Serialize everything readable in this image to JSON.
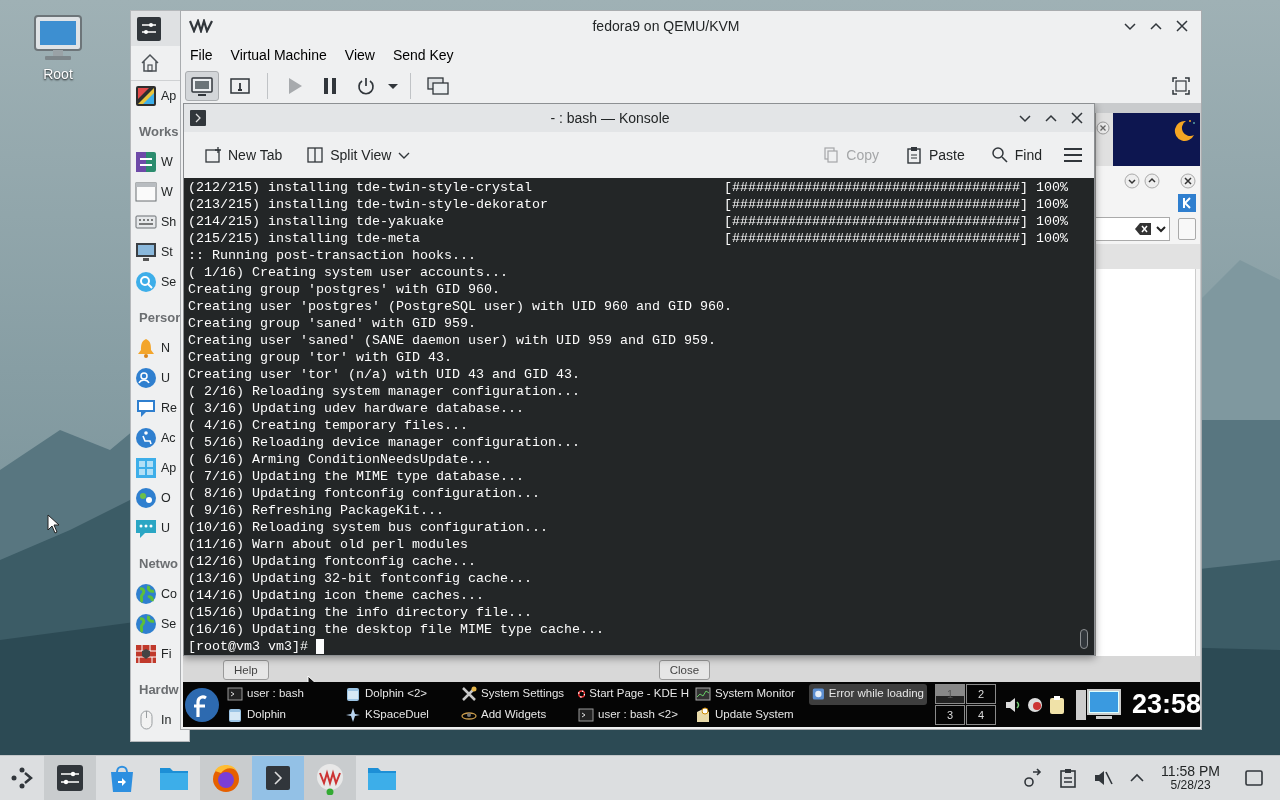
{
  "desktop": {
    "icons": [
      {
        "label": "Root"
      }
    ]
  },
  "settings_sidebar": [
    {
      "kind": "item",
      "label": "Ap"
    },
    {
      "kind": "header",
      "label": "Works"
    },
    {
      "kind": "item",
      "label": "W"
    },
    {
      "kind": "item",
      "label": "W"
    },
    {
      "kind": "item",
      "label": "Sh"
    },
    {
      "kind": "item",
      "label": "St"
    },
    {
      "kind": "item",
      "label": "Se"
    },
    {
      "kind": "header",
      "label": "Persor"
    },
    {
      "kind": "item",
      "label": "N"
    },
    {
      "kind": "item",
      "label": "U"
    },
    {
      "kind": "item",
      "label": "Re"
    },
    {
      "kind": "item",
      "label": "Ac"
    },
    {
      "kind": "item",
      "label": "Ap"
    },
    {
      "kind": "item",
      "label": "O"
    },
    {
      "kind": "item",
      "label": "U"
    },
    {
      "kind": "header",
      "label": "Netwo"
    },
    {
      "kind": "item",
      "label": "Co"
    },
    {
      "kind": "item",
      "label": "Se"
    },
    {
      "kind": "item",
      "label": "Fi"
    },
    {
      "kind": "header",
      "label": "Hardw"
    },
    {
      "kind": "item",
      "label": "In"
    }
  ],
  "vm_window": {
    "title": "fedora9 on QEMU/KVM",
    "menu": [
      "File",
      "Virtual Machine",
      "View",
      "Send Key"
    ],
    "view_buttons": [
      {
        "selected": true
      },
      {
        "selected": false
      }
    ],
    "run_buttons": [
      {
        "disabled": true
      },
      {
        "disabled": false
      },
      {
        "disabled": false
      }
    ]
  },
  "konsole": {
    "title": "- : bash — Konsole",
    "toolbar": [
      {
        "label": "New Tab",
        "disabled": false
      },
      {
        "label": "Split View",
        "disabled": false
      },
      {
        "label": "Copy",
        "disabled": true
      },
      {
        "label": "Paste",
        "disabled": false
      },
      {
        "label": "Find",
        "disabled": false
      }
    ],
    "lines": [
      {
        "kind": "progress",
        "text": "(212/215) installing tde-twin-style-crystal",
        "bar": "[####################################]",
        "percent": "100%"
      },
      {
        "kind": "progress",
        "text": "(213/215) installing tde-twin-style-dekorator",
        "bar": "[####################################]",
        "percent": "100%"
      },
      {
        "kind": "progress",
        "text": "(214/215) installing tde-yakuake",
        "bar": "[####################################]",
        "percent": "100%"
      },
      {
        "kind": "progress",
        "text": "(215/215) installing tde-meta",
        "bar": "[####################################]",
        "percent": "100%"
      },
      {
        "kind": "plain",
        "text": ":: Running post-transaction hooks..."
      },
      {
        "kind": "plain",
        "text": "( 1/16) Creating system user accounts..."
      },
      {
        "kind": "plain",
        "text": "Creating group 'postgres' with GID 960."
      },
      {
        "kind": "plain",
        "text": "Creating user 'postgres' (PostgreSQL user) with UID 960 and GID 960."
      },
      {
        "kind": "plain",
        "text": "Creating group 'saned' with GID 959."
      },
      {
        "kind": "plain",
        "text": "Creating user 'saned' (SANE daemon user) with UID 959 and GID 959."
      },
      {
        "kind": "plain",
        "text": "Creating group 'tor' with GID 43."
      },
      {
        "kind": "plain",
        "text": "Creating user 'tor' (n/a) with UID 43 and GID 43."
      },
      {
        "kind": "plain",
        "text": "( 2/16) Reloading system manager configuration..."
      },
      {
        "kind": "plain",
        "text": "( 3/16) Updating udev hardware database..."
      },
      {
        "kind": "plain",
        "text": "( 4/16) Creating temporary files..."
      },
      {
        "kind": "plain",
        "text": "( 5/16) Reloading device manager configuration..."
      },
      {
        "kind": "plain",
        "text": "( 6/16) Arming ConditionNeedsUpdate..."
      },
      {
        "kind": "plain",
        "text": "( 7/16) Updating the MIME type database..."
      },
      {
        "kind": "plain",
        "text": "( 8/16) Updating fontconfig configuration..."
      },
      {
        "kind": "plain",
        "text": "( 9/16) Refreshing PackageKit..."
      },
      {
        "kind": "plain",
        "text": "(10/16) Reloading system bus configuration..."
      },
      {
        "kind": "plain",
        "text": "(11/16) Warn about old perl modules"
      },
      {
        "kind": "plain",
        "text": "(12/16) Updating fontconfig cache..."
      },
      {
        "kind": "plain",
        "text": "(13/16) Updating 32-bit fontconfig cache..."
      },
      {
        "kind": "plain",
        "text": "(14/16) Updating icon theme caches..."
      },
      {
        "kind": "plain",
        "text": "(15/16) Updating the info directory file..."
      },
      {
        "kind": "plain",
        "text": "(16/16) Updating the desktop file MIME type cache..."
      }
    ],
    "prompt": "[root@vm3 vm3]#"
  },
  "guest_dialog": {
    "buttons": [
      "Help",
      "Close"
    ]
  },
  "guest_taskbar": {
    "tasks": [
      {
        "label": "user : bash",
        "selected": false
      },
      {
        "label": "Dolphin <2>",
        "selected": false
      },
      {
        "label": "System Settings",
        "selected": false
      },
      {
        "label": "Start Page - KDE H",
        "selected": false
      },
      {
        "label": "System Monitor",
        "selected": false
      },
      {
        "label": "Error while loading",
        "selected": true
      },
      {
        "label": "Dolphin",
        "selected": false
      },
      {
        "label": "KSpaceDuel",
        "selected": false
      },
      {
        "label": "Add Widgets",
        "selected": false
      },
      {
        "label": "user : bash <2>",
        "selected": false
      },
      {
        "label": "Update System",
        "selected": false
      }
    ],
    "desktops": [
      {
        "label": "1",
        "selected": true
      },
      {
        "label": "2",
        "selected": false
      },
      {
        "label": "3",
        "selected": false
      },
      {
        "label": "4",
        "selected": false
      }
    ],
    "clock": "23:58"
  },
  "host_taskbar": {
    "tasks": [
      {
        "open": true,
        "selected": false
      },
      {
        "open": false,
        "selected": false
      },
      {
        "open": false,
        "selected": false
      },
      {
        "open": true,
        "selected": false
      },
      {
        "open": true,
        "selected": true
      },
      {
        "open": true,
        "selected": false
      },
      {
        "open": false,
        "selected": false
      }
    ],
    "clock": "11:58 PM",
    "date": "5/28/23"
  }
}
